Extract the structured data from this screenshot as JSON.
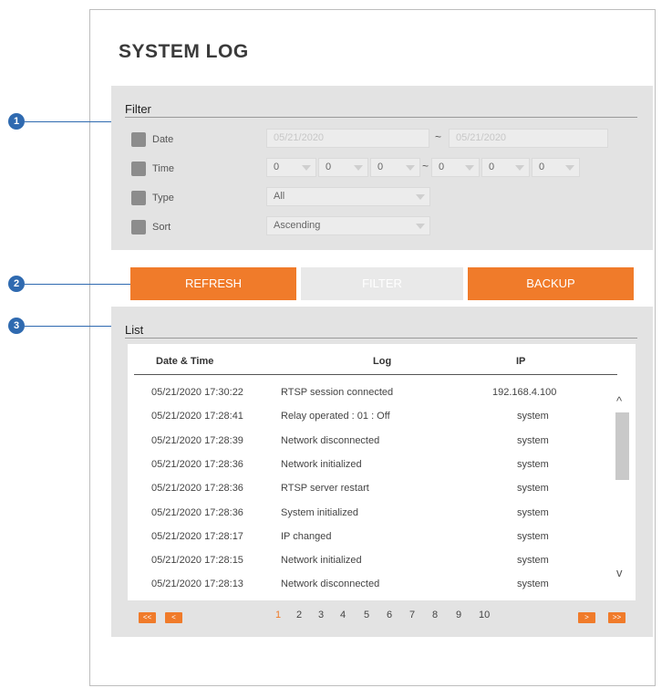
{
  "page": {
    "title": "SYSTEM LOG"
  },
  "callouts": [
    "1",
    "2",
    "3"
  ],
  "filter": {
    "heading": "Filter",
    "date": {
      "label": "Date",
      "from": "05/21/2020",
      "to": "05/21/2020",
      "separator": "~"
    },
    "time": {
      "label": "Time",
      "from": [
        "0",
        "0",
        "0"
      ],
      "to": [
        "0",
        "0",
        "0"
      ],
      "separator": "~"
    },
    "type": {
      "label": "Type",
      "value": "All"
    },
    "sort": {
      "label": "Sort",
      "value": "Ascending"
    }
  },
  "actions": {
    "refresh": "REFRESH",
    "filter": "FILTER",
    "backup": "BACKUP"
  },
  "list": {
    "heading": "List",
    "columns": [
      "Date & Time",
      "Log",
      "IP"
    ],
    "rows": [
      [
        "05/21/2020 17:30:22",
        "RTSP session connected",
        "192.168.4.100"
      ],
      [
        "05/21/2020 17:28:41",
        "Relay operated : 01 : Off",
        "system"
      ],
      [
        "05/21/2020 17:28:39",
        "Network disconnected",
        "system"
      ],
      [
        "05/21/2020 17:28:36",
        "Network initialized",
        "system"
      ],
      [
        "05/21/2020 17:28:36",
        "RTSP server restart",
        "system"
      ],
      [
        "05/21/2020 17:28:36",
        "System initialized",
        "system"
      ],
      [
        "05/21/2020 17:28:17",
        "IP changed",
        "system"
      ],
      [
        "05/21/2020 17:28:15",
        "Network initialized",
        "system"
      ],
      [
        "05/21/2020 17:28:13",
        "Network disconnected",
        "system"
      ]
    ]
  },
  "pagination": {
    "first": "<<",
    "prev": "<",
    "next": ">",
    "last": ">>",
    "pages": [
      "1",
      "2",
      "3",
      "4",
      "5",
      "6",
      "7",
      "8",
      "9",
      "10"
    ],
    "current": "1"
  },
  "icons": {
    "scroll_up": "chevron-up-icon",
    "scroll_down": "chevron-down-icon",
    "checkbox": "checkbox-icon",
    "dropdown": "caret-down-icon"
  },
  "colors": {
    "accent": "#f07b2a",
    "callout": "#2f6ab0",
    "panel": "#e3e3e3"
  }
}
